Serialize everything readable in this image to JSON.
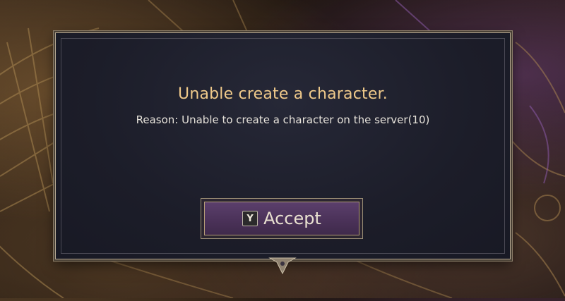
{
  "dialog": {
    "title": "Unable create a character.",
    "reason": "Reason: Unable to create a character on the server(10)",
    "accept_button": {
      "key": "Y",
      "label": "Accept"
    }
  },
  "colors": {
    "title": "#efc98a",
    "reason": "#e6e2da",
    "button_fill": "#4b3259",
    "dialog_bg": "#1c1d29",
    "frame": "#b7aa93"
  }
}
